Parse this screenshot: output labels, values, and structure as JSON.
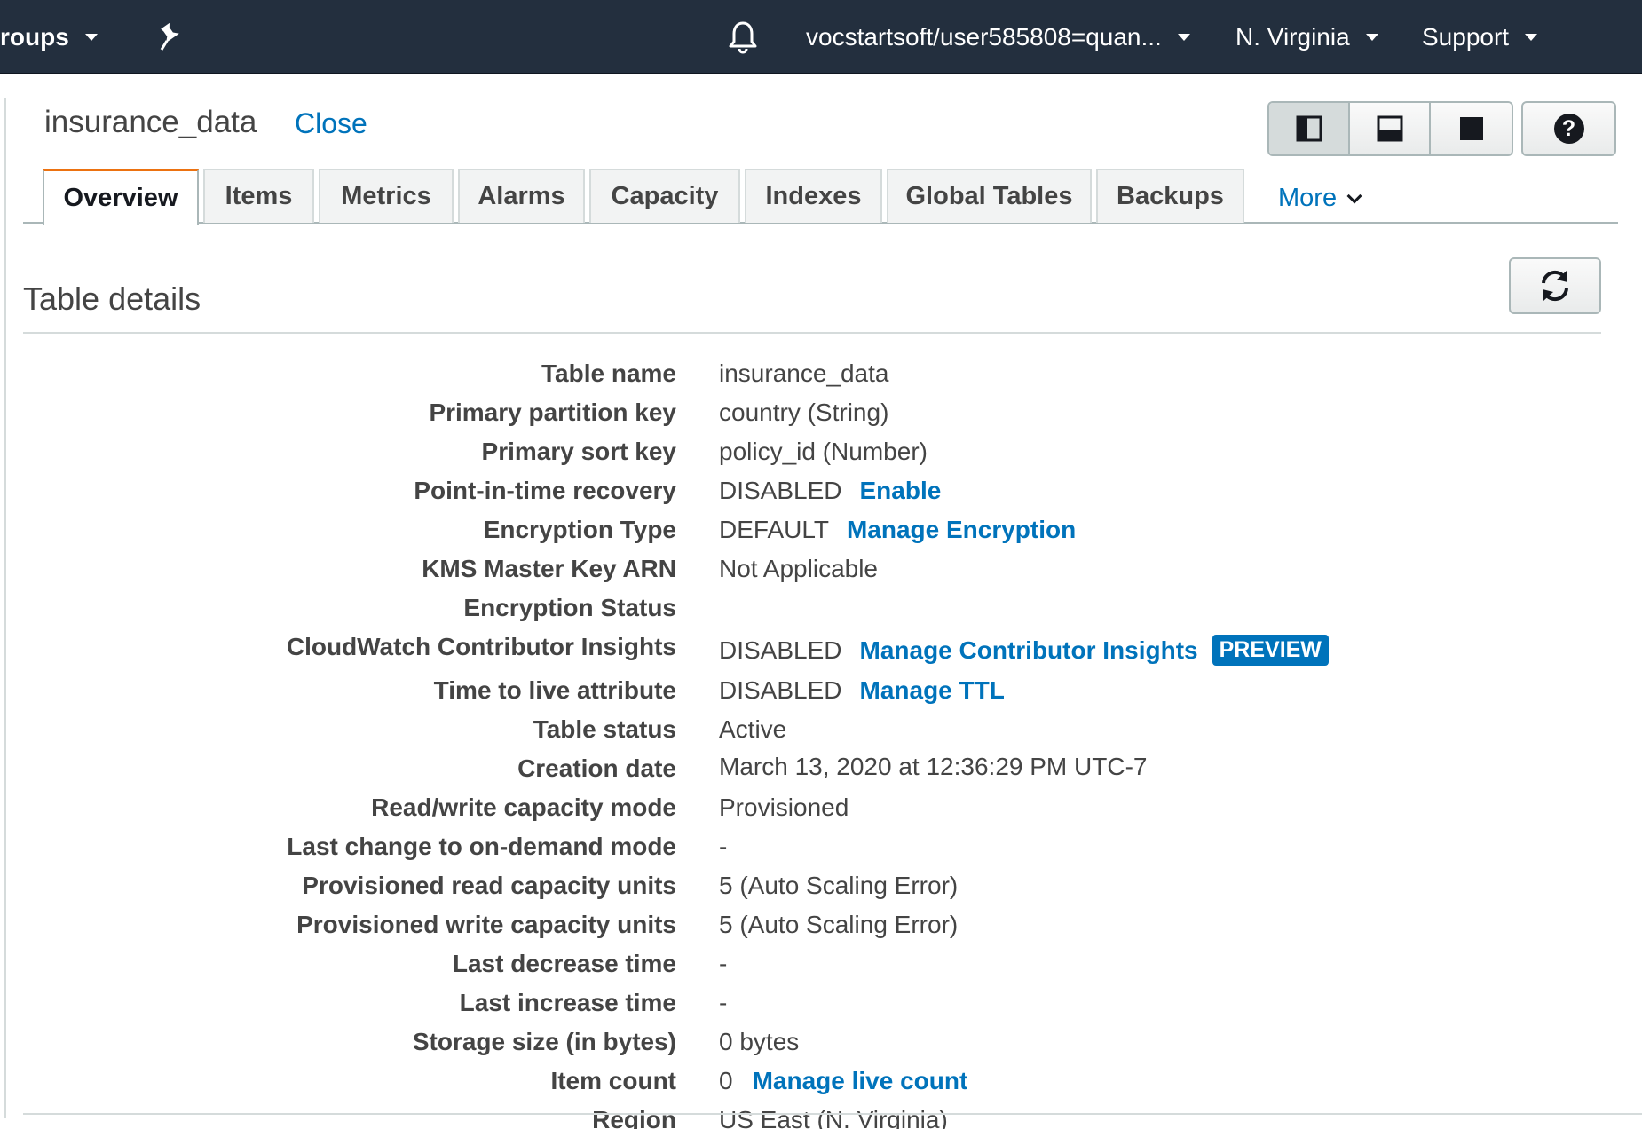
{
  "topnav": {
    "groups_label": "roups",
    "account_label": "vocstartsoft/user585808=quan...",
    "region_label": "N. Virginia",
    "support_label": "Support"
  },
  "header": {
    "table_title": "insurance_data",
    "close_label": "Close",
    "help_label": "?"
  },
  "tabs": [
    {
      "label": "Overview"
    },
    {
      "label": "Items"
    },
    {
      "label": "Metrics"
    },
    {
      "label": "Alarms"
    },
    {
      "label": "Capacity"
    },
    {
      "label": "Indexes"
    },
    {
      "label": "Global Tables"
    },
    {
      "label": "Backups"
    }
  ],
  "more_label": "More",
  "section_title": "Table details",
  "details": [
    {
      "label": "Table name",
      "value": "insurance_data",
      "link": "",
      "badge": ""
    },
    {
      "label": "Primary partition key",
      "value": "country (String)",
      "link": "",
      "badge": ""
    },
    {
      "label": "Primary sort key",
      "value": "policy_id (Number)",
      "link": "",
      "badge": ""
    },
    {
      "label": "Point-in-time recovery",
      "value": "DISABLED",
      "link": "Enable",
      "badge": ""
    },
    {
      "label": "Encryption Type",
      "value": "DEFAULT",
      "link": "Manage Encryption",
      "badge": ""
    },
    {
      "label": "KMS Master Key ARN",
      "value": "Not Applicable",
      "link": "",
      "badge": ""
    },
    {
      "label": "Encryption Status",
      "value": "",
      "link": "",
      "badge": ""
    },
    {
      "label": "CloudWatch Contributor Insights",
      "value": "DISABLED",
      "link": "Manage Contributor Insights",
      "badge": "PREVIEW"
    },
    {
      "label": "Time to live attribute",
      "value": "DISABLED",
      "link": "Manage TTL",
      "badge": ""
    },
    {
      "label": "Table status",
      "value": "Active",
      "link": "",
      "badge": ""
    },
    {
      "label": "Creation date",
      "value": "March 13, 2020 at 12:36:29 PM UTC-7",
      "link": "",
      "badge": ""
    },
    {
      "label": "Read/write capacity mode",
      "value": "Provisioned",
      "link": "",
      "badge": ""
    },
    {
      "label": "Last change to on-demand mode",
      "value": "-",
      "link": "",
      "badge": ""
    },
    {
      "label": "Provisioned read capacity units",
      "value": "5 (Auto Scaling Error)",
      "link": "",
      "badge": ""
    },
    {
      "label": "Provisioned write capacity units",
      "value": "5 (Auto Scaling Error)",
      "link": "",
      "badge": ""
    },
    {
      "label": "Last decrease time",
      "value": "-",
      "link": "",
      "badge": ""
    },
    {
      "label": "Last increase time",
      "value": "-",
      "link": "",
      "badge": ""
    },
    {
      "label": "Storage size (in bytes)",
      "value": "0 bytes",
      "link": "",
      "badge": ""
    },
    {
      "label": "Item count",
      "value": "0",
      "link": "Manage live count",
      "badge": ""
    },
    {
      "label": "Region",
      "value": "US East (N. Virginia)",
      "link": "",
      "badge": ""
    }
  ],
  "colors": {
    "nav_bg": "#232f3e",
    "link": "#0073bb",
    "active_tab_accent": "#ec7211"
  }
}
